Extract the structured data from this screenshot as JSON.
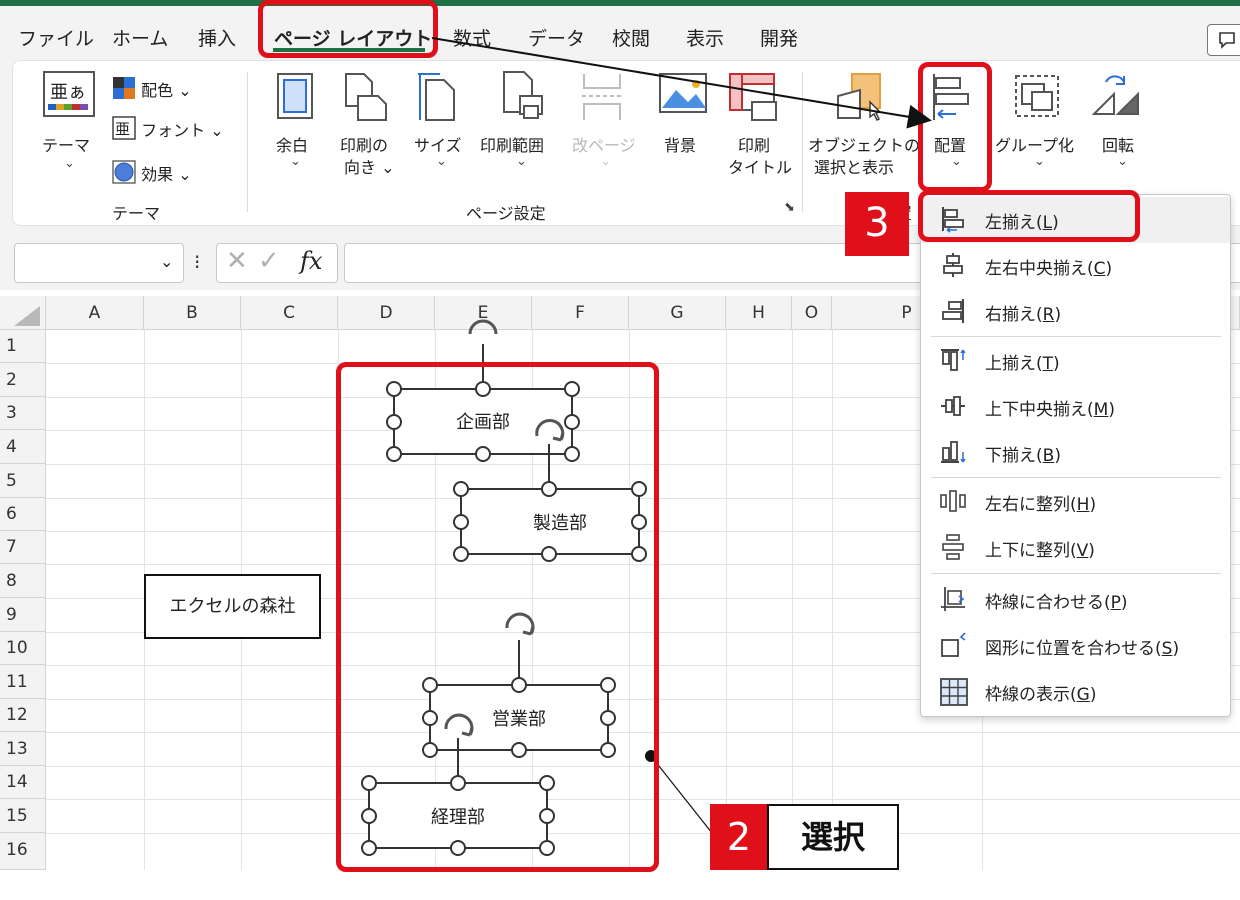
{
  "tabs": [
    {
      "label": "ファイル"
    },
    {
      "label": "ホーム"
    },
    {
      "label": "挿入"
    },
    {
      "label": "ページ レイアウト"
    },
    {
      "label": "数式"
    },
    {
      "label": "データ"
    },
    {
      "label": "校閲"
    },
    {
      "label": "表示"
    },
    {
      "label": "開発"
    }
  ],
  "ribbon": {
    "theme_group": {
      "theme_button": "テーマ",
      "colors": "配色",
      "fonts": "フォント",
      "effects": "効果",
      "group_label": "テーマ"
    },
    "page_setup": {
      "margins": "余白",
      "orientation_1": "印刷の",
      "orientation_2": "向き",
      "size": "サイズ",
      "print_area": "印刷範囲",
      "breaks": "改ページ",
      "background": "背景",
      "print_titles_1": "印刷",
      "print_titles_2": "タイトル",
      "group_label": "ページ設定"
    },
    "arrange": {
      "selection_pane_1": "オブジェクトの",
      "selection_pane_2": "選択と表示",
      "align": "配置",
      "group": "グループ化",
      "rotate": "回転",
      "group_label_partial": "置"
    }
  },
  "formula_bar": {
    "name_box": "",
    "fx": "fx",
    "formula": ""
  },
  "columns": [
    "A",
    "B",
    "C",
    "D",
    "E",
    "F",
    "G",
    "H",
    "O",
    "P"
  ],
  "rows": [
    "1",
    "2",
    "3",
    "4",
    "5",
    "6",
    "7",
    "8",
    "9",
    "10",
    "11",
    "12",
    "13",
    "14",
    "15",
    "16"
  ],
  "cell_text": "エクセルの森社",
  "shapes": [
    {
      "label": "企画部"
    },
    {
      "label": "製造部"
    },
    {
      "label": "営業部"
    },
    {
      "label": "経理部"
    }
  ],
  "align_menu": {
    "items": [
      {
        "text": "左揃え(",
        "key": "L",
        "end": ")"
      },
      {
        "text": "左右中央揃え(",
        "key": "C",
        "end": ")"
      },
      {
        "text": "右揃え(",
        "key": "R",
        "end": ")"
      },
      {
        "text": "上揃え(",
        "key": "T",
        "end": ")"
      },
      {
        "text": "上下中央揃え(",
        "key": "M",
        "end": ")"
      },
      {
        "text": "下揃え(",
        "key": "B",
        "end": ")"
      },
      {
        "text": "左右に整列(",
        "key": "H",
        "end": ")"
      },
      {
        "text": "上下に整列(",
        "key": "V",
        "end": ")"
      },
      {
        "text": "枠線に合わせる(",
        "key": "P",
        "end": ")"
      },
      {
        "text": "図形に位置を合わせる(",
        "key": "S",
        "end": ")"
      },
      {
        "text": "枠線の表示(",
        "key": "G",
        "end": ")"
      }
    ]
  },
  "annotations": {
    "step2_number": "2",
    "step2_text": "選択",
    "step3_number": "3"
  },
  "colors": {
    "accent_green": "#1e7145",
    "annotation_red": "#e0101a",
    "blue_icon": "#2b6fd6"
  }
}
